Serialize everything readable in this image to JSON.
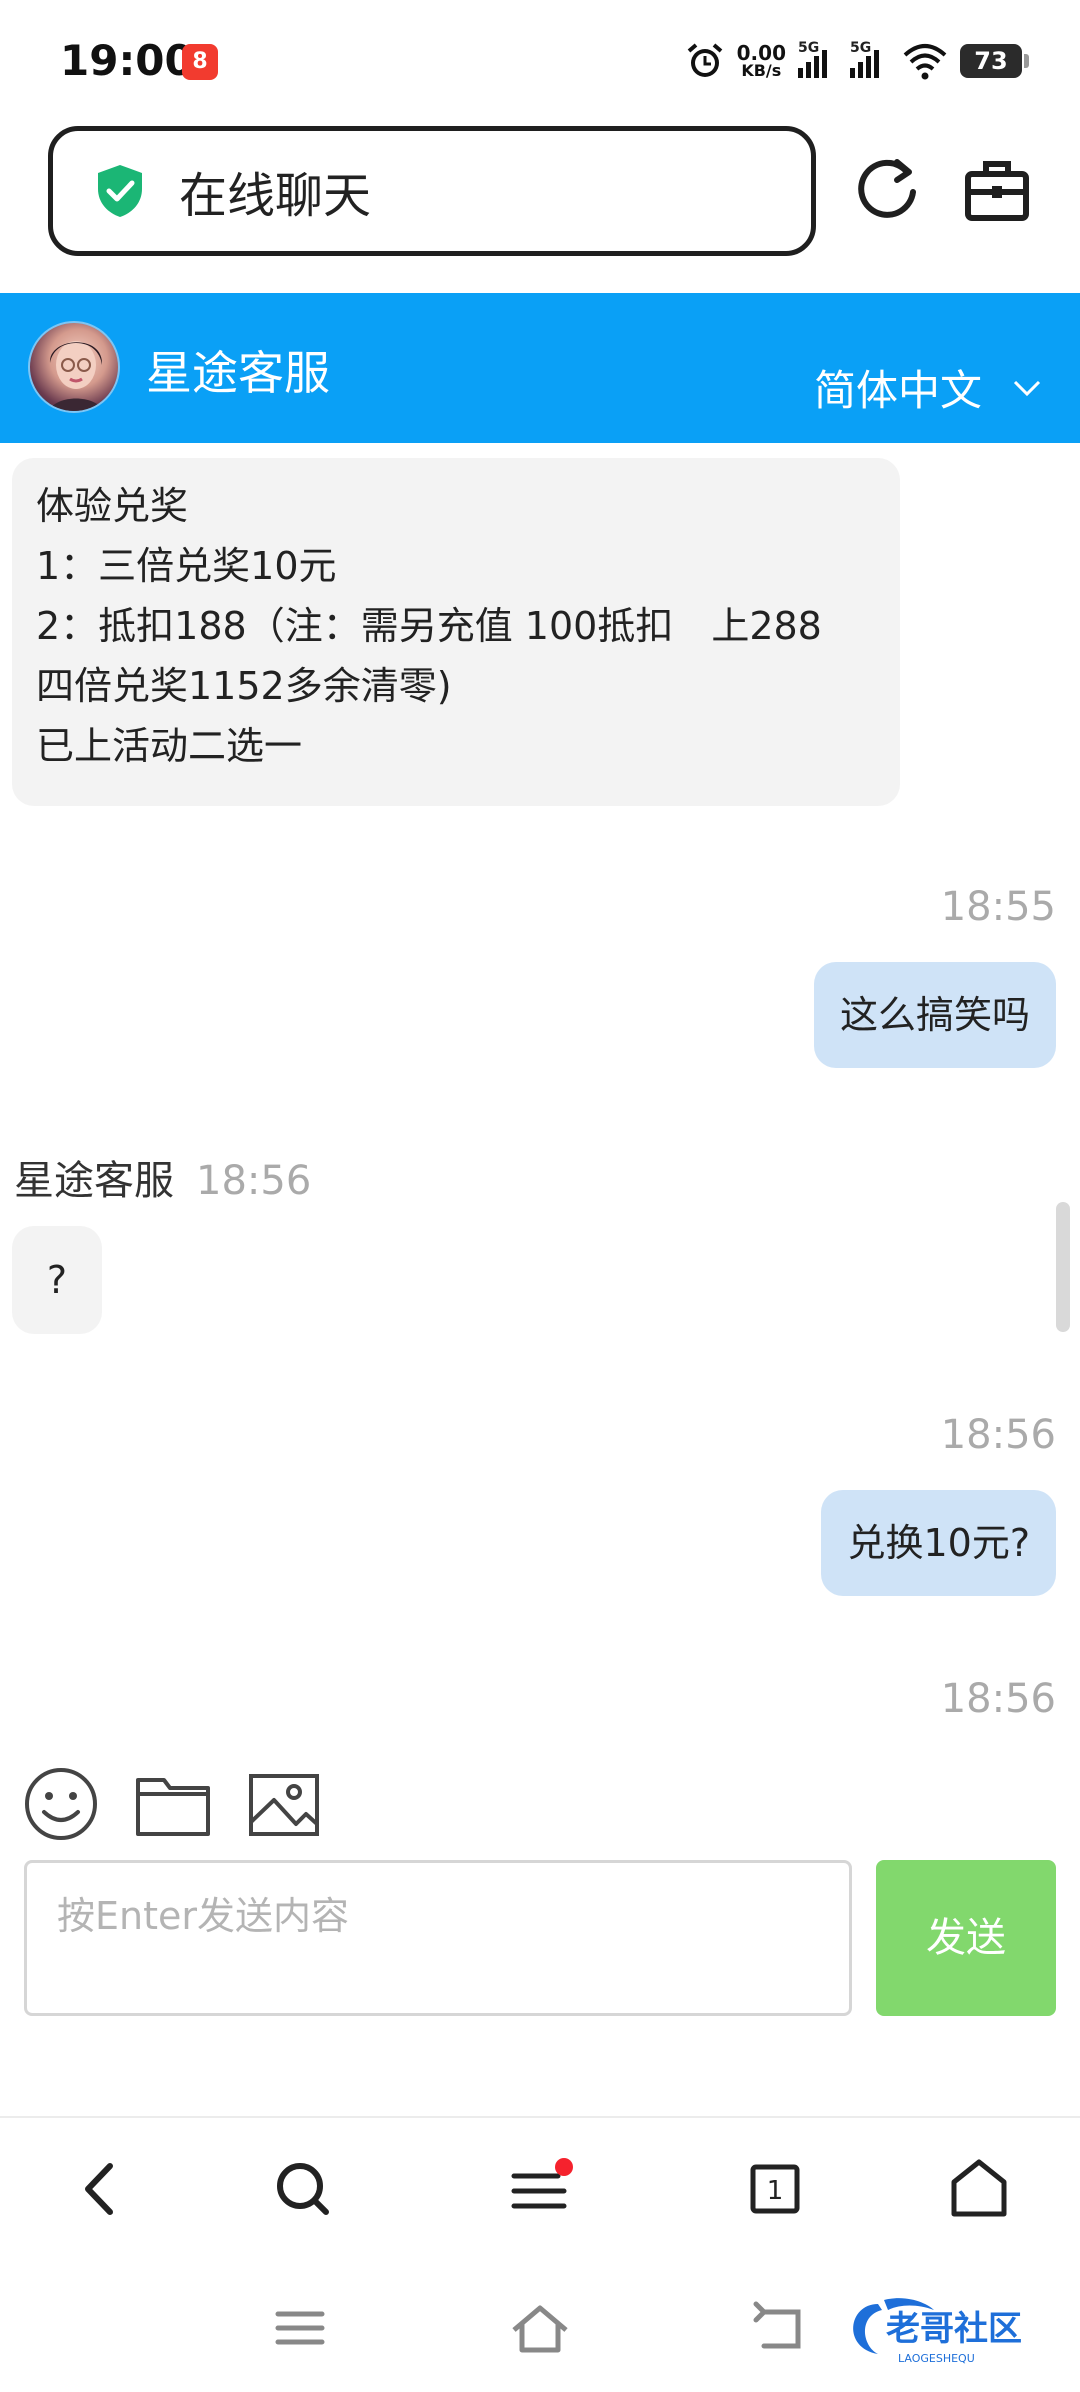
{
  "status_bar": {
    "time": "19:00",
    "app_badge": "8",
    "net_speed_value": "0.00",
    "net_speed_unit": "KB/s",
    "signal_1_label": "5G",
    "signal_2_label": "5G",
    "battery": "73"
  },
  "address_bar": {
    "title": "在线聊天",
    "shield_icon": "shield-check-icon",
    "shield_color": "#1bb675"
  },
  "header": {
    "agent_name": "星途客服",
    "language": "简体中文",
    "background": "#0aa0f6"
  },
  "messages": {
    "m1_lines": [
      "体验兑奖",
      "1：三倍兑奖10元",
      "2：抵扣188（注：需另充值 100抵扣　上288",
      "四倍兑奖1152多余清零)",
      "已上活动二选一"
    ],
    "t1": "18:55",
    "m2": "这么搞笑吗",
    "sender": "星途客服",
    "sender_time": "18:56",
    "m3": "?",
    "t2": "18:56",
    "m4": "兑换10元?",
    "t3": "18:56"
  },
  "composer": {
    "placeholder": "按Enter发送内容",
    "send_label": "发送",
    "send_color": "#82d86d",
    "tools": [
      "emoji-icon",
      "folder-icon",
      "image-icon"
    ]
  },
  "browser_nav": {
    "icons": [
      "back-icon",
      "search-icon",
      "menu-icon",
      "tabs-icon",
      "home-icon"
    ],
    "tab_count": "1",
    "notification_color": "#f5222d"
  },
  "system_nav": {
    "icons": [
      "recents-icon",
      "home-icon",
      "back-icon"
    ]
  },
  "watermark": {
    "text": "老哥社区",
    "subtext": "LAOGESHEQU"
  }
}
